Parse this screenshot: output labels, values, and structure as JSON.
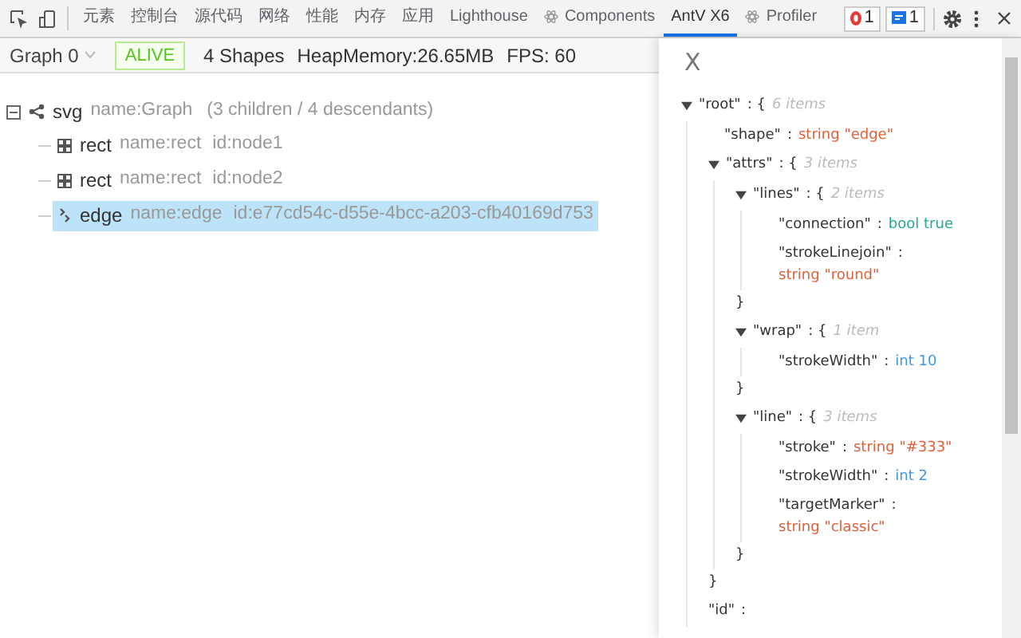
{
  "devtools_tabs": [
    {
      "label": "元素",
      "selected": false,
      "kind": "plain"
    },
    {
      "label": "控制台",
      "selected": false,
      "kind": "plain"
    },
    {
      "label": "源代码",
      "selected": false,
      "kind": "plain"
    },
    {
      "label": "网络",
      "selected": false,
      "kind": "plain"
    },
    {
      "label": "性能",
      "selected": false,
      "kind": "plain"
    },
    {
      "label": "内存",
      "selected": false,
      "kind": "plain"
    },
    {
      "label": "应用",
      "selected": false,
      "kind": "plain"
    },
    {
      "label": "Lighthouse",
      "selected": false,
      "kind": "plain"
    },
    {
      "label": "Components",
      "selected": false,
      "kind": "react"
    },
    {
      "label": "AntV X6",
      "selected": true,
      "kind": "plain"
    },
    {
      "label": "Profiler",
      "selected": false,
      "kind": "react"
    }
  ],
  "error_count": "1",
  "message_count": "1",
  "toolbar": {
    "graph_select": "Graph 0",
    "status": "ALIVE",
    "shapes": "4 Shapes",
    "heap": "HeapMemory:26.65MB",
    "fps": "FPS: 60"
  },
  "tree": {
    "expanded": true,
    "tag": "svg",
    "name": "name:Graph",
    "summary": "(3 children / 4 descendants)",
    "children": [
      {
        "kind": "node",
        "tag": "rect",
        "name": "name:rect",
        "id": "id:node1",
        "selected": false
      },
      {
        "kind": "node",
        "tag": "rect",
        "name": "name:rect",
        "id": "id:node2",
        "selected": false
      },
      {
        "kind": "edge",
        "tag": "edge",
        "name": "name:edge",
        "id": "id:e77cd54c-d55e-4bcc-a203-cfb40169d753",
        "selected": true
      }
    ]
  },
  "inspector": {
    "close": "X",
    "punct": {
      "colon": ":",
      "open": "{",
      "close": "}"
    },
    "root": {
      "kind": "object",
      "key": "\"root\"",
      "count": "6 items",
      "expanded": true,
      "closed": false,
      "children": [
        {
          "kind": "prop",
          "key": "\"shape\"",
          "type": "string",
          "value": "\"edge\"",
          "wrap": false
        },
        {
          "kind": "object",
          "key": "\"attrs\"",
          "count": "3 items",
          "expanded": true,
          "closed": true,
          "children": [
            {
              "kind": "object",
              "key": "\"lines\"",
              "count": "2 items",
              "expanded": true,
              "closed": true,
              "children": [
                {
                  "kind": "prop",
                  "key": "\"connection\"",
                  "type": "bool",
                  "value": "true",
                  "wrap": false
                },
                {
                  "kind": "prop",
                  "key": "\"strokeLinejoin\"",
                  "type": "string",
                  "value": "\"round\"",
                  "wrap": true
                }
              ]
            },
            {
              "kind": "object",
              "key": "\"wrap\"",
              "count": "1 item",
              "expanded": true,
              "closed": true,
              "children": [
                {
                  "kind": "prop",
                  "key": "\"strokeWidth\"",
                  "type": "int",
                  "value": "10",
                  "wrap": false
                }
              ]
            },
            {
              "kind": "object",
              "key": "\"line\"",
              "count": "3 items",
              "expanded": true,
              "closed": true,
              "children": [
                {
                  "kind": "prop",
                  "key": "\"stroke\"",
                  "type": "string",
                  "value": "\"#333\"",
                  "wrap": false
                },
                {
                  "kind": "prop",
                  "key": "\"strokeWidth\"",
                  "type": "int",
                  "value": "2",
                  "wrap": false
                },
                {
                  "kind": "prop",
                  "key": "\"targetMarker\"",
                  "type": "string",
                  "value": "\"classic\"",
                  "wrap": true
                }
              ]
            }
          ]
        },
        {
          "kind": "cut",
          "key": "\"id\""
        }
      ]
    }
  }
}
